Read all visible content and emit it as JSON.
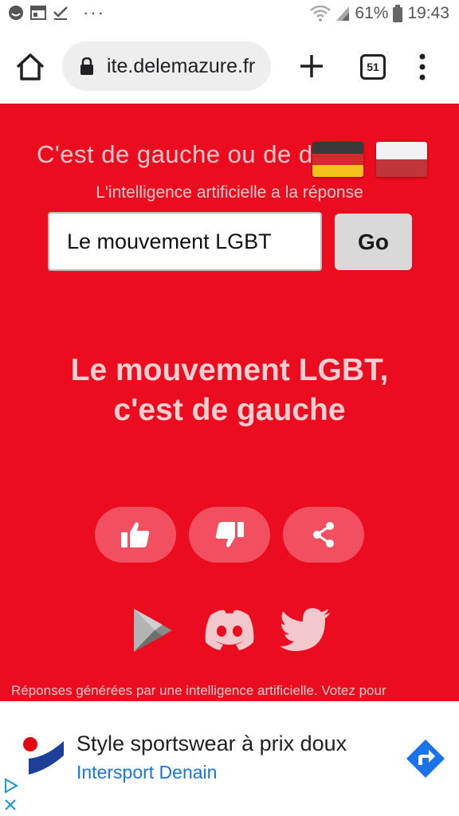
{
  "status_bar": {
    "battery": "61%",
    "time": "19:43",
    "more": "···"
  },
  "browser": {
    "url": "ite.delemazure.fr",
    "tab_count": "51"
  },
  "page": {
    "title": "C'est de gauche ou de droite",
    "subtitle": "L'intelligence artificielle a la réponse",
    "input_value": "Le mouvement LGBT",
    "go_label": "Go",
    "result_line1": "Le mouvement LGBT,",
    "result_line2": "c'est de gauche",
    "footer": "Réponses générées par une intelligence artificielle. Votez pour",
    "colors": {
      "background": "#ec0c1f",
      "button": "#f25060"
    }
  },
  "ad": {
    "title": "Style sportswear à prix doux",
    "advertiser": "Intersport Denain"
  },
  "icons": [
    "home-icon",
    "lock-icon",
    "plus-icon",
    "tabs-icon",
    "menu-icon",
    "thumbs-up-icon",
    "thumbs-down-icon",
    "share-icon",
    "google-play-icon",
    "discord-icon",
    "twitter-icon"
  ]
}
